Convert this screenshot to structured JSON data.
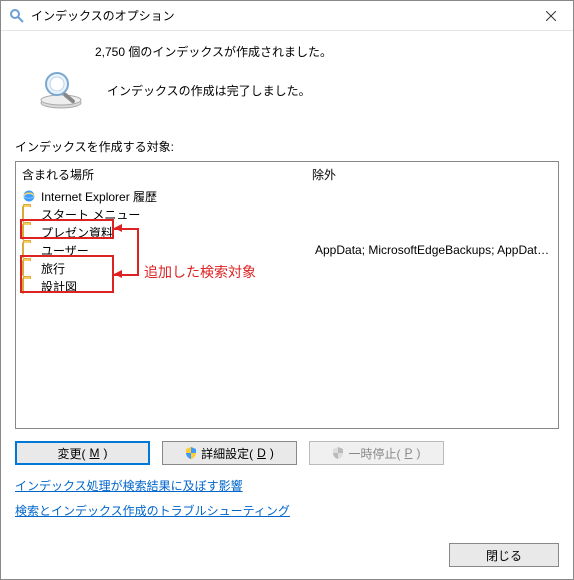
{
  "window": {
    "title": "インデックスのオプション"
  },
  "status": {
    "count_text": "2,750 個のインデックスが作成されました。",
    "done_text": "インデックスの作成は完了しました。"
  },
  "section": {
    "label": "インデックスを作成する対象:"
  },
  "columns": {
    "include": "含まれる場所",
    "exclude": "除外"
  },
  "locations": [
    {
      "icon": "ie",
      "name": "Internet Explorer 履歴",
      "exclude": ""
    },
    {
      "icon": "folder",
      "name": "スタート メニュー",
      "exclude": ""
    },
    {
      "icon": "folder",
      "name": "プレゼン資料",
      "exclude": ""
    },
    {
      "icon": "folder",
      "name": "ユーザー",
      "exclude": "AppData; MicrosoftEdgeBackups; AppData; Mi..."
    },
    {
      "icon": "folder",
      "name": "旅行",
      "exclude": ""
    },
    {
      "icon": "folder",
      "name": "設計図",
      "exclude": ""
    }
  ],
  "annotation": {
    "text": "追加した検索対象"
  },
  "buttons": {
    "modify_pre": "変更(",
    "modify_key": "M",
    "modify_post": ")",
    "advanced_pre": "詳細設定(",
    "advanced_key": "D",
    "advanced_post": ")",
    "pause_pre": "一時停止(",
    "pause_key": "P",
    "pause_post": ")"
  },
  "links": {
    "impact": "インデックス処理が検索結果に及ぼす影響",
    "troubleshoot": "検索とインデックス作成のトラブルシューティング"
  },
  "footer": {
    "close": "閉じる"
  }
}
